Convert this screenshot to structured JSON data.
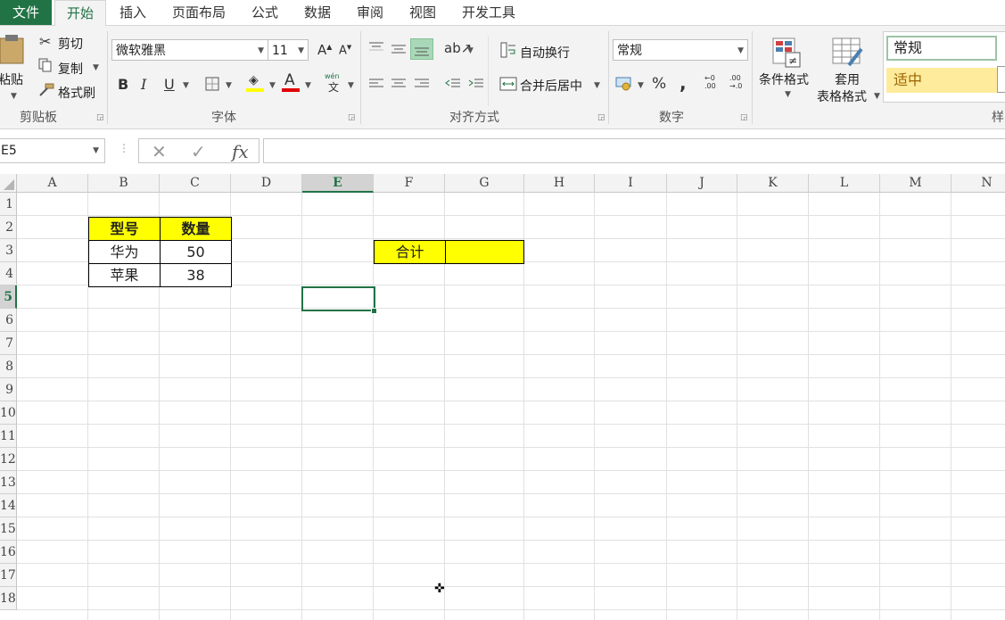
{
  "tabs": [
    "文件",
    "开始",
    "插入",
    "页面布局",
    "公式",
    "数据",
    "审阅",
    "视图",
    "开发工具"
  ],
  "clipboard": {
    "paste": "粘贴",
    "cut": "剪切",
    "copy": "复制",
    "format_painter": "格式刷",
    "group": "剪贴板"
  },
  "font": {
    "name": "微软雅黑",
    "size": "11",
    "bold": "B",
    "italic": "I",
    "underline": "U",
    "color_letter": "A",
    "phonetic": "wén",
    "group": "字体"
  },
  "alignment": {
    "wrap": "自动换行",
    "merge": "合并后居中",
    "group": "对齐方式"
  },
  "number": {
    "format": "常规",
    "percent": "%",
    "comma": ",",
    "group": "数字"
  },
  "styles": {
    "conditional": "条件格式",
    "table_line1": "套用",
    "table_line2": "表格格式",
    "normal": "常规",
    "neutral": "适中",
    "group": "样"
  },
  "formula_bar": {
    "name_box": "E5",
    "value": ""
  },
  "columns": [
    "A",
    "B",
    "C",
    "D",
    "E",
    "F",
    "G",
    "H",
    "I",
    "J",
    "K",
    "L",
    "M",
    "N"
  ],
  "rows": [
    "1",
    "2",
    "3",
    "4",
    "5",
    "6",
    "7",
    "8",
    "9",
    "10",
    "11",
    "12",
    "13",
    "14",
    "15",
    "16",
    "17",
    "18"
  ],
  "selected_cell": "E5",
  "table": {
    "header": [
      "型号",
      "数量"
    ],
    "rows": [
      [
        "华为",
        "50"
      ],
      [
        "苹果",
        "38"
      ]
    ]
  },
  "summary": {
    "label": "合计",
    "value": ""
  },
  "colors": {
    "accent": "#217346",
    "highlight": "#ffff00"
  }
}
